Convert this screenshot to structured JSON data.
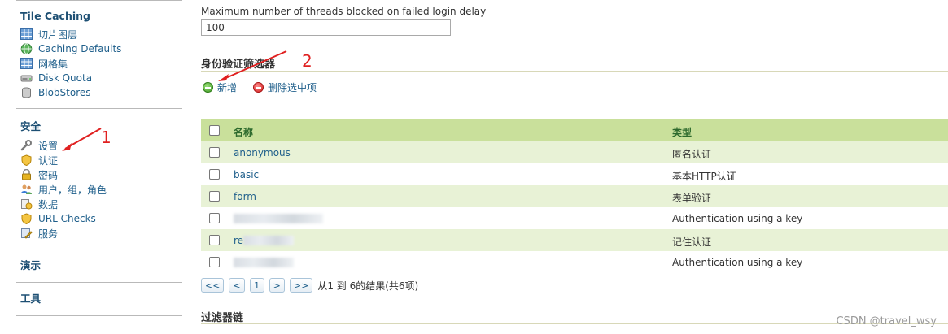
{
  "sidebar": {
    "tile_caching": {
      "title": "Tile Caching",
      "items": [
        {
          "label": "切片图层",
          "icon": "grid-icon"
        },
        {
          "label": "Caching Defaults",
          "icon": "globe-icon"
        },
        {
          "label": "网格集",
          "icon": "grid-icon"
        },
        {
          "label": "Disk Quota",
          "icon": "disk-icon"
        },
        {
          "label": "BlobStores",
          "icon": "database-icon"
        }
      ]
    },
    "security": {
      "title": "安全",
      "items": [
        {
          "label": "设置",
          "icon": "wrench-icon"
        },
        {
          "label": "认证",
          "icon": "shield-icon"
        },
        {
          "label": "密码",
          "icon": "lock-icon"
        },
        {
          "label": "用户，组，角色",
          "icon": "users-icon"
        },
        {
          "label": "数据",
          "icon": "data-icon"
        },
        {
          "label": "URL Checks",
          "icon": "shield-icon"
        },
        {
          "label": "服务",
          "icon": "service-icon"
        }
      ]
    },
    "demos": {
      "title": "演示"
    },
    "tools": {
      "title": "工具"
    }
  },
  "main": {
    "threads_label": "Maximum number of threads blocked on failed login delay",
    "threads_value": "100",
    "auth_filters_title": "身份验证筛选器",
    "add_label": "新增",
    "remove_label": "删除选中项",
    "table": {
      "col_name": "名称",
      "col_type": "类型",
      "rows": [
        {
          "name": "anonymous",
          "type": "匿名认证"
        },
        {
          "name": "basic",
          "type": "基本HTTP认证"
        },
        {
          "name": "form",
          "type": "表单验证"
        },
        {
          "name": "",
          "type": "Authentication using a key"
        },
        {
          "name": "re",
          "type": "记住认证"
        },
        {
          "name": "",
          "type": "Authentication using a key"
        }
      ]
    },
    "pager": {
      "first": "<<",
      "prev": "<",
      "page": "1",
      "next": ">",
      "last": ">>",
      "summary": "从1 到 6的结果(共6项)"
    },
    "filter_chain_title": "过滤器链"
  },
  "annotations": {
    "marker_1": "1",
    "marker_2": "2"
  },
  "watermark": "CSDN @travel_wsy",
  "colors": {
    "accent": "#1f5f8b",
    "header_green": "#c9e09b",
    "row_alt": "#e8f2d6",
    "annotation": "#e02020"
  }
}
